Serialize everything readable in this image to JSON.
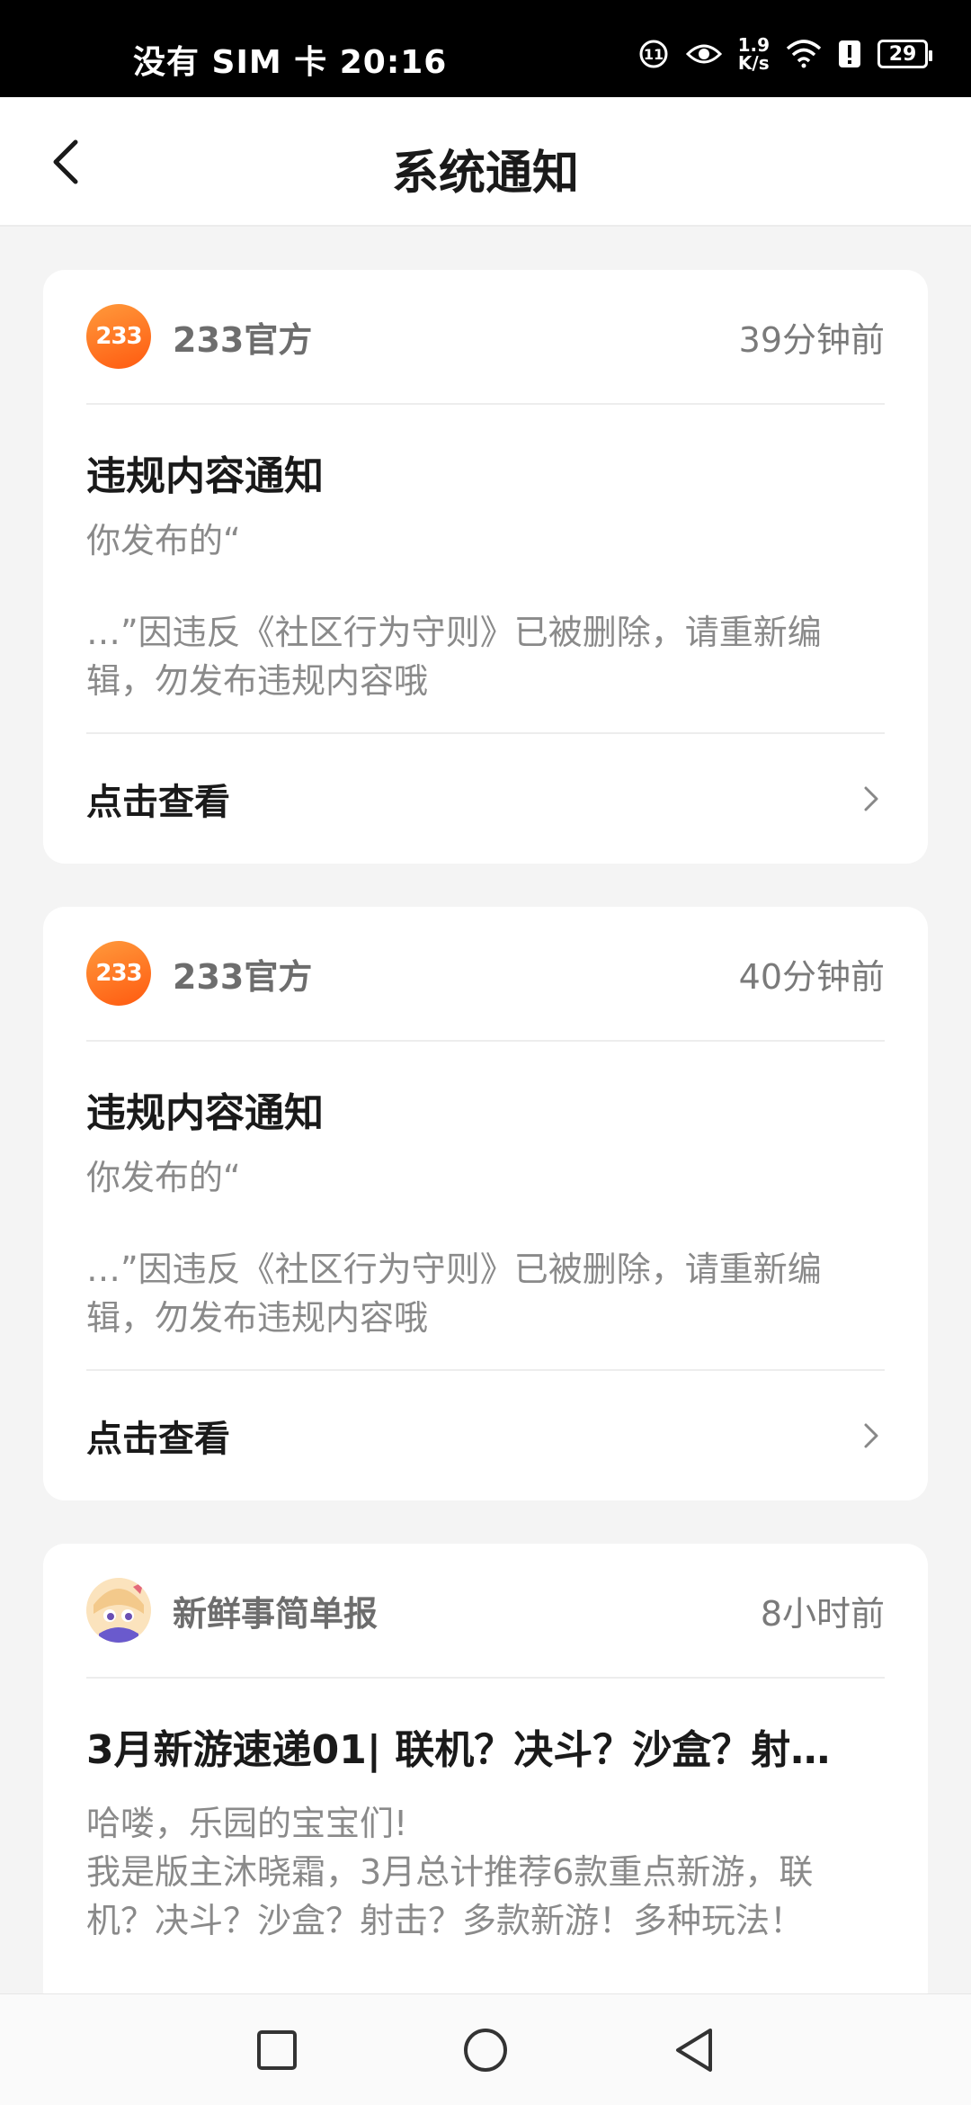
{
  "status_bar": {
    "left_text": "没有 SIM 卡 20:16",
    "net_speed_value": "1.9",
    "net_speed_unit": "K/s",
    "battery": "29"
  },
  "header": {
    "title": "系统通知"
  },
  "notifications": [
    {
      "sender": "233官方",
      "avatar_text": "233",
      "time": "39分钟前",
      "title": "违规内容通知",
      "body_line1": "你发布的“",
      "body_line2": "   …”因违反《社区行为守则》已被删除，请重新编辑，勿发布违规内容哦",
      "action": "点击查看"
    },
    {
      "sender": "233官方",
      "avatar_text": "233",
      "time": "40分钟前",
      "title": "违规内容通知",
      "body_line1": "你发布的“",
      "body_line2": "   …”因违反《社区行为守则》已被删除，请重新编辑，勿发布违规内容哦",
      "action": "点击查看"
    },
    {
      "sender": "新鲜事简单报",
      "time": "8小时前",
      "title": "3月新游速递01| 联机？决斗？沙盒？射…",
      "body_line1": "哈喽，乐园的宝宝们!",
      "body_line2": "我是版主沐晓霜，3月总计推荐6款重点新游，联机？决斗？沙盒？射击？多款新游！多种玩法！"
    }
  ],
  "colors": {
    "accent_orange": "#ff6a1f",
    "text_primary": "#1a1a1a",
    "text_secondary": "#8a8a8a"
  }
}
